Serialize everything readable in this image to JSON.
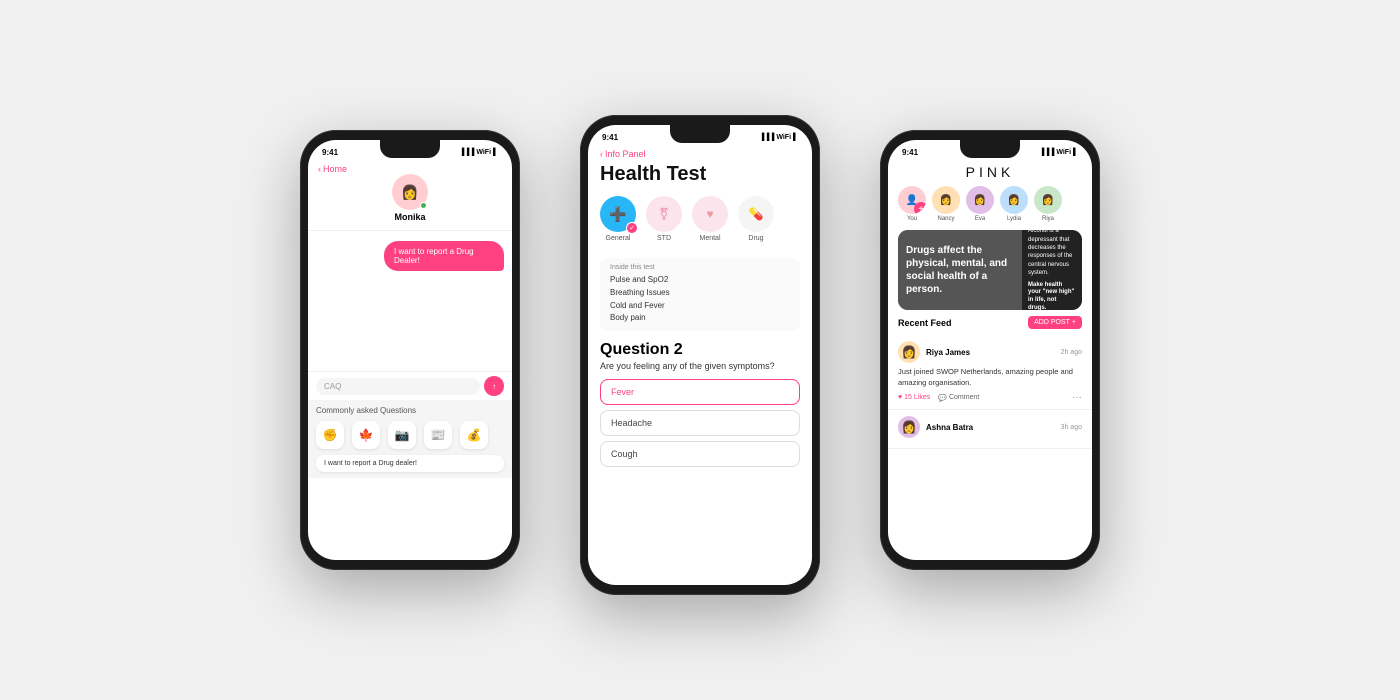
{
  "phone1": {
    "status_time": "9:41",
    "back_label": "Home",
    "user_name": "Monika",
    "user_avatar": "👩",
    "message_bubble": "I want to report a Drug Dealer!",
    "input_placeholder": "CAQ",
    "faq_title": "Commonly asked Questions",
    "faq_icons": [
      "✊",
      "🍁",
      "📷",
      "📰",
      "💰"
    ],
    "faq_suggestion": "I want to report a Drug dealer!"
  },
  "phone2": {
    "status_time": "9:41",
    "back_label": "Info Panel",
    "title": "Health Test",
    "categories": [
      {
        "label": "General",
        "icon": "➕",
        "style": "active",
        "checked": true
      },
      {
        "label": "STD",
        "icon": "⚧",
        "style": "pink",
        "checked": false
      },
      {
        "label": "Mental",
        "icon": "❤",
        "style": "red",
        "checked": false
      },
      {
        "label": "Drug",
        "icon": "💊",
        "style": "gray",
        "checked": false
      }
    ],
    "inside_label": "Inside this test",
    "inside_items": [
      "Pulse and SpO2",
      "Breathing Issues",
      "Cold and Fever",
      "Body pain"
    ],
    "question_num": "Question 2",
    "question_text": "Are you feeling any of the given symptoms?",
    "symptoms": [
      {
        "label": "Fever",
        "selected": true
      },
      {
        "label": "Headache",
        "selected": false
      },
      {
        "label": "Cough",
        "selected": false
      }
    ]
  },
  "phone3": {
    "status_time": "9:41",
    "logo": "PINK",
    "stories": [
      {
        "name": "You",
        "add": true
      },
      {
        "name": "Nancy"
      },
      {
        "name": "Eva"
      },
      {
        "name": "Lydia"
      },
      {
        "name": "Riya"
      }
    ],
    "banner_main_text": "Drugs affect the physical, mental, and social health of a person.",
    "banner_side_text": "Alcohol is a depressant that decreases the responses of the central nervous system.",
    "banner_cta": "Make health your \"new high\" in life, not drugs.",
    "recent_feed_title": "Recent Feed",
    "add_post_label": "ADD POST",
    "posts": [
      {
        "author": "Riya James",
        "time": "2h ago",
        "content": "Just joined SWOP Netherlands, amazing people and amazing organisation.",
        "likes": "15 Likes",
        "comment": "Comment"
      },
      {
        "author": "Ashna Batra",
        "time": "3h ago",
        "content": ""
      }
    ]
  }
}
